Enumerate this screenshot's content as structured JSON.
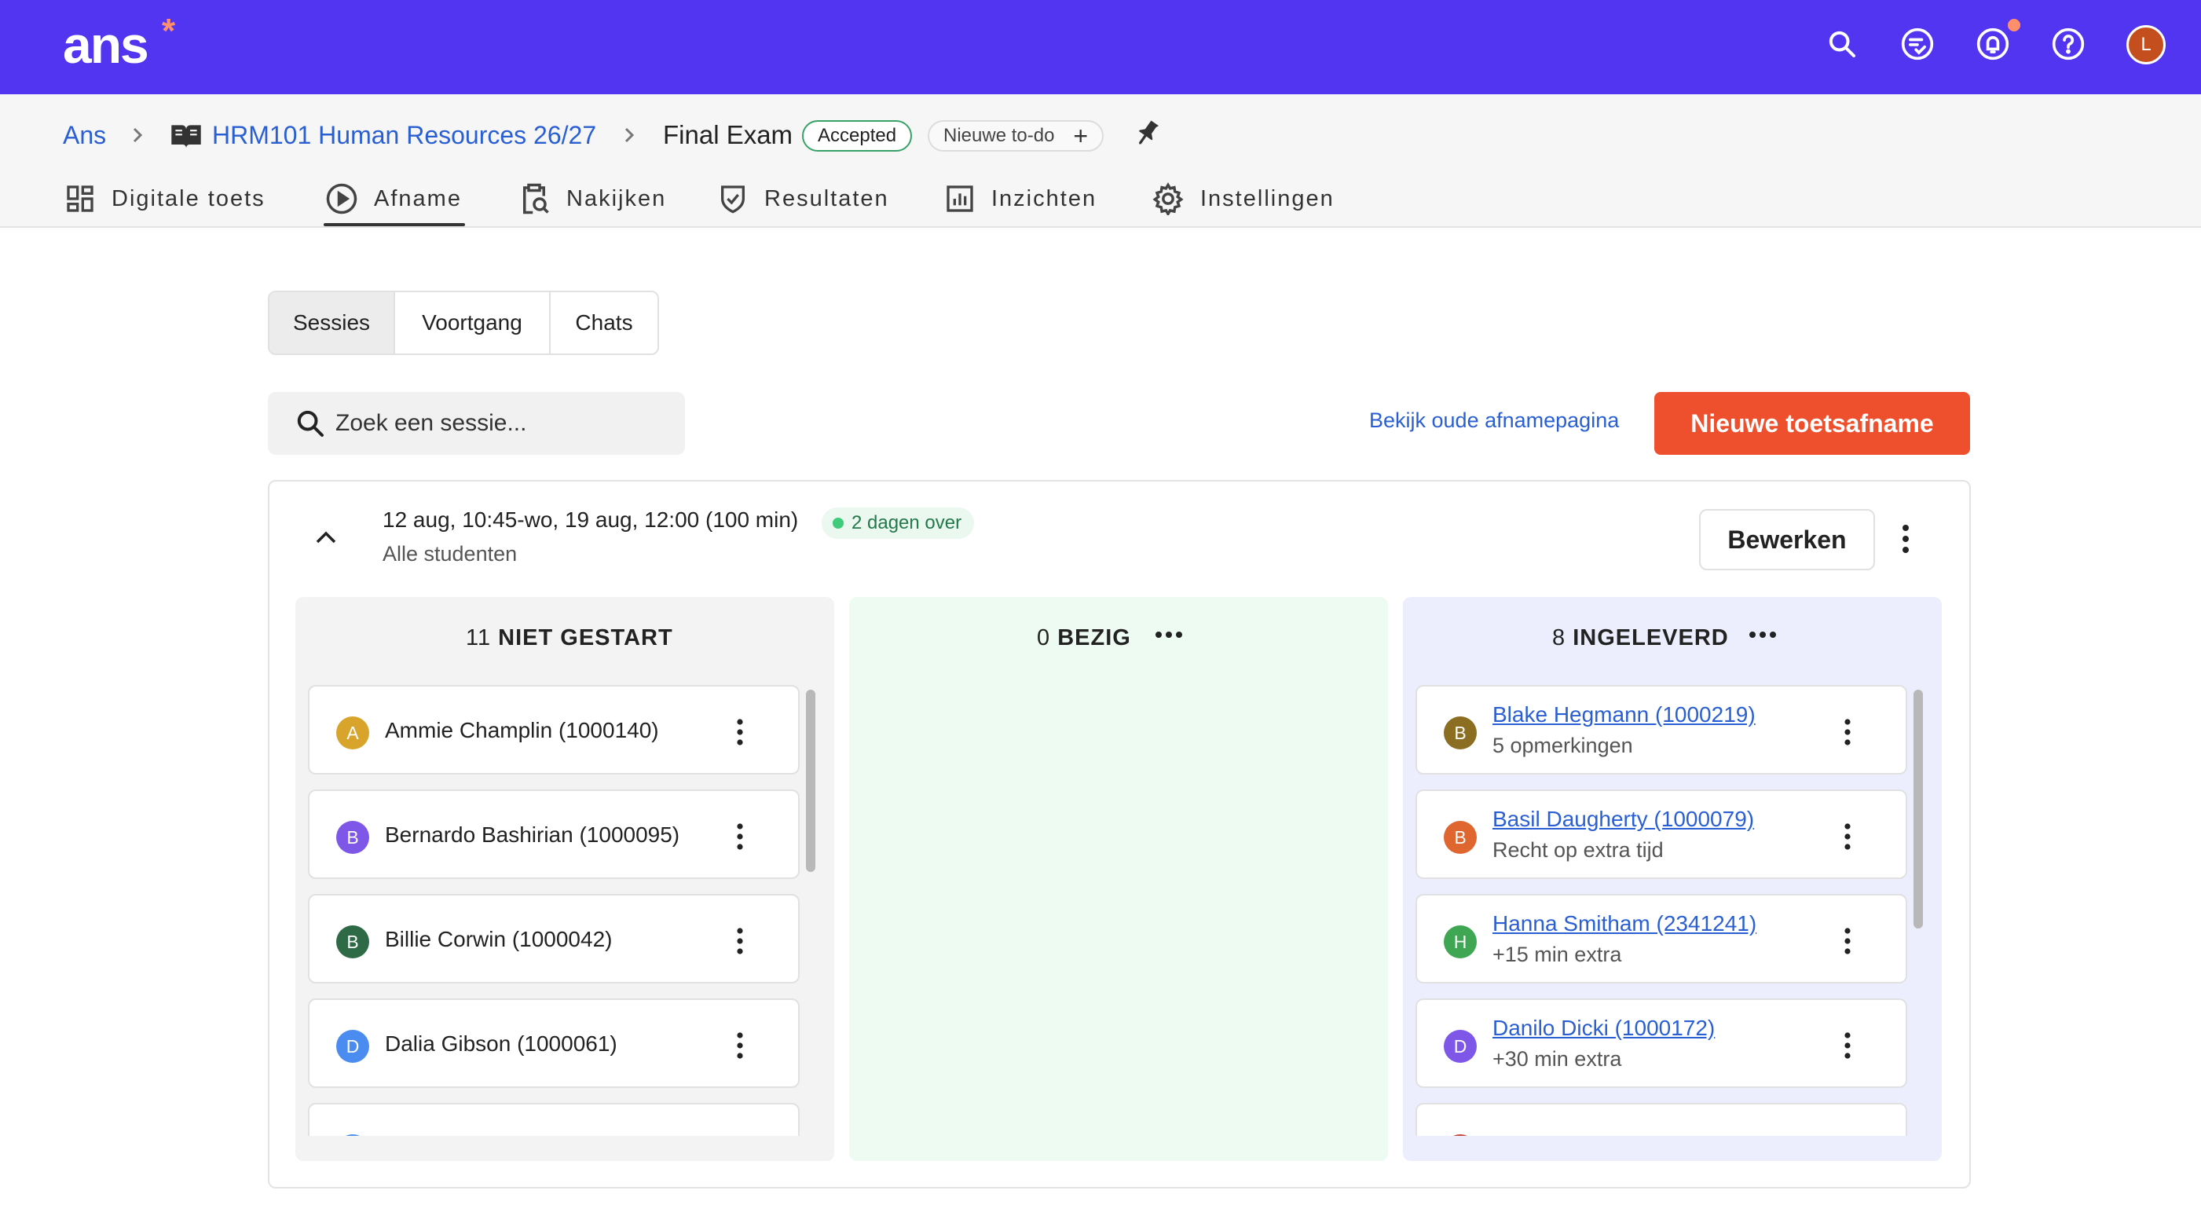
{
  "app": {
    "logo": "ans",
    "logo_mark": "*"
  },
  "topbar": {
    "icons": [
      "search-icon",
      "checklist-icon",
      "bell-icon",
      "help-icon"
    ],
    "user_initial": "L",
    "notification_color": "#ff8e6a",
    "brand_color": "#5235f0"
  },
  "breadcrumb": {
    "root": "Ans",
    "course": "HRM101 Human Resources 26/27",
    "current": "Final Exam",
    "status": "Accepted",
    "todo": "Nieuwe to-do"
  },
  "nav": {
    "tabs": [
      {
        "label": "Digitale toets",
        "icon": "grid-icon"
      },
      {
        "label": "Afname",
        "icon": "play-icon",
        "active": true
      },
      {
        "label": "Nakijken",
        "icon": "clipboard-search-icon"
      },
      {
        "label": "Resultaten",
        "icon": "shield-check-icon"
      },
      {
        "label": "Inzichten",
        "icon": "bar-chart-icon"
      },
      {
        "label": "Instellingen",
        "icon": "gear-icon"
      }
    ]
  },
  "segments": {
    "sessies": "Sessies",
    "voortgang": "Voortgang",
    "chats": "Chats",
    "active": "Sessies"
  },
  "search": {
    "placeholder": "Zoek een sessie..."
  },
  "actions": {
    "old_page": "Bekijk oude afnamepagina",
    "new_exam": "Nieuwe toetsafname",
    "accent": "#ee4f2c"
  },
  "session": {
    "date": "12 aug, 10:45-wo, 19 aug, 12:00 (100 min)",
    "audience": "Alle studenten",
    "remaining": "2 dagen over",
    "edit": "Bewerken"
  },
  "columns": {
    "not_started": {
      "count": "11",
      "title": "NIET GESTART",
      "bg": "#f3f3f3",
      "students": [
        {
          "initial": "A",
          "name": "Ammie Champlin (1000140)",
          "color": "#d9a42b"
        },
        {
          "initial": "B",
          "name": "Bernardo Bashirian (1000095)",
          "color": "#7e57e8"
        },
        {
          "initial": "B",
          "name": "Billie Corwin (1000042)",
          "color": "#2e6a46"
        },
        {
          "initial": "D",
          "name": "Dalia Gibson (1000061)",
          "color": "#4a8cf0"
        }
      ]
    },
    "busy": {
      "count": "0",
      "title": "BEZIG",
      "bg": "#edfbf3"
    },
    "submitted": {
      "count": "8",
      "title": "INGELEVERD",
      "bg": "#eceefd",
      "students": [
        {
          "initial": "B",
          "name": "Blake Hegmann (1000219)",
          "note": "5 opmerkingen",
          "color": "#8c6e22"
        },
        {
          "initial": "B",
          "name": "Basil Daugherty (1000079)",
          "note": "Recht op extra tijd",
          "color": "#e0662f"
        },
        {
          "initial": "H",
          "name": "Hanna Smitham (2341241)",
          "note": "+15 min extra",
          "color": "#3fa653"
        },
        {
          "initial": "D",
          "name": "Danilo Dicki (1000172)",
          "note": "+30 min extra",
          "color": "#7e57e8"
        }
      ]
    }
  }
}
